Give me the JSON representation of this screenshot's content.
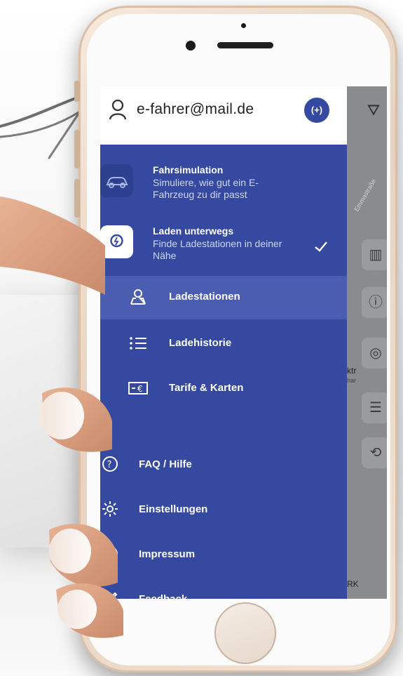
{
  "user": {
    "email": "e-fahrer@mail.de",
    "icon": "person-icon",
    "switch_icon": "switch-account-icon"
  },
  "modes": [
    {
      "title": "Fahrsimulation",
      "description": "Simuliere, wie gut ein E-Fahrzeug zu dir passt",
      "icon": "car-icon",
      "selected": false
    },
    {
      "title": "Laden unterwegs",
      "description": "Finde Ladestationen in deiner Nähe",
      "icon": "charging-pin-icon",
      "selected": true
    }
  ],
  "subnav": [
    {
      "label": "Ladestationen",
      "icon": "map-pin-icon",
      "active": true
    },
    {
      "label": "Ladehistorie",
      "icon": "list-icon",
      "active": false
    },
    {
      "label": "Tarife & Karten",
      "icon": "euro-card-icon",
      "active": false
    }
  ],
  "nav": [
    {
      "label": "FAQ / Hilfe",
      "icon": "help-icon"
    },
    {
      "label": "Einstellungen",
      "icon": "gear-icon"
    },
    {
      "label": "Impressum",
      "icon": "info-icon"
    },
    {
      "label": "Feedback",
      "icon": "feedback-icon"
    }
  ],
  "map": {
    "street": "Emmastraße",
    "label_partial_1": "ktr",
    "label_partial_2": "har",
    "label_partial_3": "RK"
  },
  "colors": {
    "drawer": "#3549a0",
    "active_item": "#4a5db0",
    "header": "#ffffff"
  }
}
